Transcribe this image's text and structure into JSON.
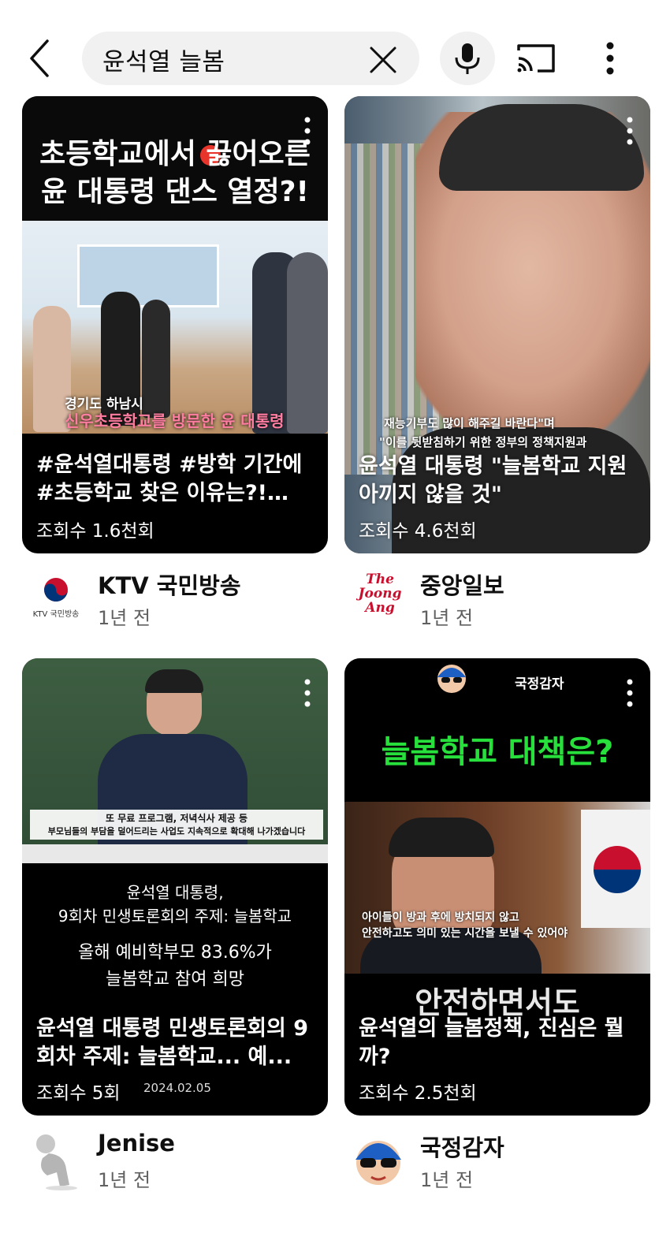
{
  "search": {
    "query": "윤석열 늘봄"
  },
  "colors": {
    "background": "#ffffff",
    "search_bg": "#f1f1f1",
    "secondary_text": "#606060"
  },
  "icons": {
    "back": "back-arrow-icon",
    "clear": "close-icon",
    "mic": "microphone-icon",
    "cast": "cast-icon",
    "more": "more-vertical-icon"
  },
  "videos": [
    {
      "overlay_heading": "초등학교에서 끓어오른 윤 대통령 댄스 열정?!",
      "caption_small": "경기도 하남시",
      "caption_highlight": "신우초등학교를 방문한 윤 대통령",
      "title": "#윤석열대통령 #방학 기간에 #초등학교 찾은 이유는?!…",
      "views": "조회수 1.6천회",
      "channel": "KTV 국민방송",
      "channel_logo_text": "KTV 국민방송",
      "time": "1년 전"
    },
    {
      "caption_line1": "재능기부도 많이 해주길 바란다\"며",
      "caption_line2": "\"이를 뒷받침하기 위한 정부의 정책지원과",
      "title": "윤석열 대통령 \"늘봄학교 지원 아끼지 않을 것\"",
      "views": "조회수 4.6천회",
      "channel": "중앙일보",
      "channel_logo_text": "The Joong Ang",
      "time": "1년 전"
    },
    {
      "banner_line1": "또 무료 프로그램, 저녁식사 제공 등",
      "banner_line2": "부모님들의 부담을 덜어드리는 사업도 지속적으로 확대해 나가겠습니다",
      "body_line1": "윤석열 대통령,",
      "body_line2": "9회차 민생토론회의 주제: 늘봄학교",
      "body_line3": "올해 예비학부모 83.6%가",
      "body_line4": "늘봄학교 참여 희망",
      "title": "윤석열 대통령 민생토론회의 9회차 주제: 늘봄학교... 예...",
      "views": "조회수 5회",
      "date_stamp": "2024.02.05",
      "channel": "Jenise",
      "time": "1년 전"
    },
    {
      "header_label": "국정감자",
      "overlay_heading": "늘봄학교 대책은?",
      "caption_line1": "아이들이 방과 후에 방치되지 않고",
      "caption_line2": "안전하고도 의미 있는 시간을 보낼 수 있어야",
      "big_caption": "안전하면서도",
      "title": "윤석열의 늘봄정책, 진심은 뭘까?",
      "views": "조회수 2.5천회",
      "channel": "국정감자",
      "time": "1년 전"
    }
  ]
}
